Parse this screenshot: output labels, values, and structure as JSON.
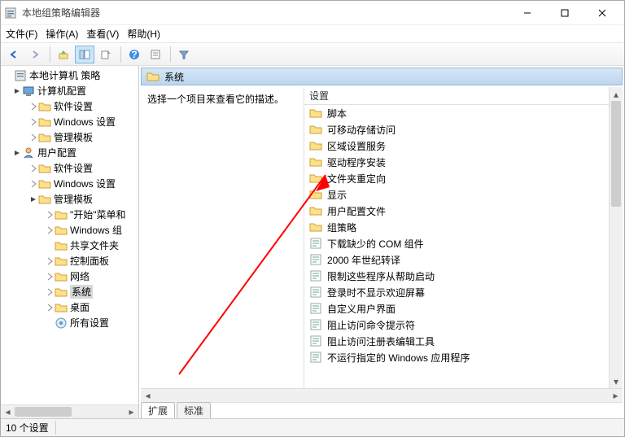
{
  "window": {
    "title": "本地组策略编辑器"
  },
  "menu": {
    "file": "文件(F)",
    "action": "操作(A)",
    "view": "查看(V)",
    "help": "帮助(H)"
  },
  "tree": {
    "root": "本地计算机 策略",
    "computer": "计算机配置",
    "computer_children": {
      "software": "软件设置",
      "windows": "Windows 设置",
      "admin": "管理模板"
    },
    "user": "用户配置",
    "user_children": {
      "software": "软件设置",
      "windows": "Windows 设置",
      "admin": "管理模板",
      "admin_children": {
        "start": "\"开始\"菜单和",
        "wincomp": "Windows 组",
        "shared": "共享文件夹",
        "cpl": "控制面板",
        "network": "网络",
        "system": "系统",
        "desktop": "桌面",
        "all": "所有设置"
      }
    }
  },
  "header": {
    "title": "系统"
  },
  "description": {
    "prompt": "选择一个项目来查看它的描述。"
  },
  "list": {
    "column": "设置",
    "items": [
      {
        "type": "folder",
        "label": "脚本"
      },
      {
        "type": "folder",
        "label": "可移动存储访问"
      },
      {
        "type": "folder",
        "label": "区域设置服务"
      },
      {
        "type": "folder",
        "label": "驱动程序安装"
      },
      {
        "type": "folder",
        "label": "文件夹重定向"
      },
      {
        "type": "folder",
        "label": "显示"
      },
      {
        "type": "folder",
        "label": "用户配置文件"
      },
      {
        "type": "folder",
        "label": "组策略"
      },
      {
        "type": "setting",
        "label": "下载缺少的 COM 组件"
      },
      {
        "type": "setting",
        "label": "2000 年世纪转译"
      },
      {
        "type": "setting",
        "label": "限制这些程序从帮助启动"
      },
      {
        "type": "setting",
        "label": "登录时不显示欢迎屏幕"
      },
      {
        "type": "setting",
        "label": "自定义用户界面"
      },
      {
        "type": "setting",
        "label": "阻止访问命令提示符"
      },
      {
        "type": "setting",
        "label": "阻止访问注册表编辑工具"
      },
      {
        "type": "setting",
        "label": "不运行指定的 Windows 应用程序"
      }
    ]
  },
  "tabs": {
    "extended": "扩展",
    "standard": "标准"
  },
  "status": {
    "count": "10 个设置"
  },
  "icons": {
    "gpedit": "gpedit-icon",
    "folder": "folder-icon",
    "setting": "setting-icon",
    "computer": "computer-icon",
    "user": "user-icon",
    "allsettings": "all-settings-icon"
  }
}
